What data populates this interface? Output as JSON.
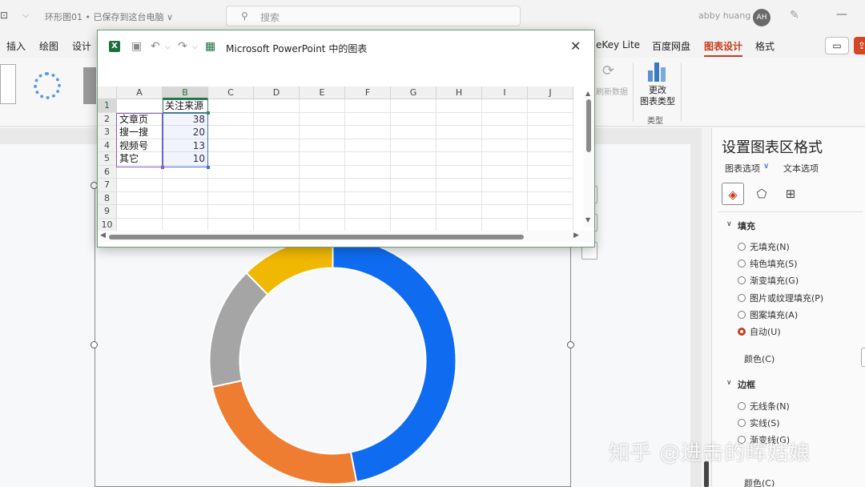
{
  "titlebar": {
    "doc_title": "环形图01 • 已保存到这台电脑 ∨",
    "search_placeholder": "搜索",
    "user_name": "abby huang",
    "avatar_initials": "AH"
  },
  "ribbon": {
    "tabs": [
      "插入",
      "绘图",
      "设计",
      "eKey Lite",
      "百度网盘",
      "图表设计",
      "格式"
    ],
    "active_tab": "图表设计",
    "refresh_data_label": "刷新数据",
    "change_type_label": "更改\n图表类型",
    "type_group_label": "类型"
  },
  "excel_dialog": {
    "title": "Microsoft PowerPoint 中的图表",
    "columns": [
      "A",
      "B",
      "C",
      "D",
      "E",
      "F",
      "G",
      "H",
      "I",
      "J"
    ],
    "rows": [
      "1",
      "2",
      "3",
      "4",
      "5",
      "6",
      "7",
      "8",
      "9",
      "10"
    ],
    "header_value": "关注来源",
    "categories": [
      "文章页",
      "搜一搜",
      "视频号",
      "其它"
    ],
    "values": [
      "38",
      "20",
      "13",
      "10"
    ]
  },
  "chart_data": {
    "type": "pie",
    "donut": true,
    "categories": [
      "文章页",
      "搜一搜",
      "视频号",
      "其它"
    ],
    "values": [
      38,
      20,
      13,
      10
    ],
    "colors": [
      "#0f6cf0",
      "#ee7d31",
      "#a5a5a5",
      "#f0b800"
    ]
  },
  "format_pane": {
    "title": "设置图表区格式",
    "tab_chart_options": "图表选项",
    "tab_text_options": "文本选项",
    "fill_section": "填充",
    "fill_options": [
      "无填充(N)",
      "纯色填充(S)",
      "渐变填充(G)",
      "图片或纹理填充(P)",
      "图案填充(A)",
      "自动(U)"
    ],
    "fill_selected_index": 5,
    "color_label": "颜色(C)",
    "border_section": "边框",
    "border_options": [
      "无线条(N)",
      "实线(S)",
      "渐变线(G)"
    ]
  },
  "watermark": "知乎 @进击的晖姑娘"
}
